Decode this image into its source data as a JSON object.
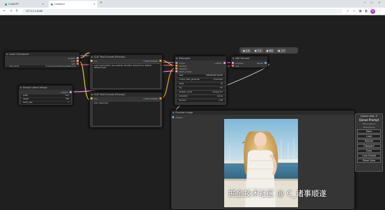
{
  "browser": {
    "tabs": [
      {
        "label": "ChatGPT",
        "active": false
      },
      {
        "label": "ComfyUI",
        "active": true
      }
    ],
    "url": "127.0.0.1:8188"
  },
  "nodes": {
    "load_checkpoint": {
      "title": "Load Checkpoint",
      "outputs": [
        "MODEL",
        "CLIP",
        "VAE"
      ],
      "widget_label": "ckpt_name",
      "widget_value": "v1-5-pruned-emaonly.safetensors"
    },
    "empty_latent": {
      "title": "Empty Latent Image",
      "output": "LATENT",
      "widgets": [
        {
          "label": "width",
          "value": "512"
        },
        {
          "label": "height",
          "value": "768"
        },
        {
          "label": "batch_size",
          "value": "1"
        }
      ]
    },
    "clip_pos": {
      "title": "CLIP Text Encode (Prompt)",
      "input": "clip",
      "output": "CONDITIONING",
      "text": "a girl, best quality, sea, seaside, beautiful, sharp focus, highres, detailed eyes"
    },
    "clip_neg": {
      "title": "CLIP Text Encode (Prompt)",
      "input": "clip",
      "output": "CONDITIONING",
      "text": "text, watermark"
    },
    "ksampler": {
      "title": "KSampler",
      "inputs": [
        "model",
        "positive",
        "negative",
        "latent_image"
      ],
      "output": "LATENT",
      "widgets": [
        {
          "label": "seed",
          "value": "156680208700286"
        },
        {
          "label": "control_after_generate",
          "value": "randomize"
        },
        {
          "label": "steps",
          "value": "20"
        },
        {
          "label": "cfg",
          "value": "8.0"
        },
        {
          "label": "sampler_name",
          "value": "dpmpp_2m"
        },
        {
          "label": "scheduler",
          "value": "karras"
        },
        {
          "label": "denoise",
          "value": "1.00"
        }
      ]
    },
    "vae_decode": {
      "title": "VAE Decode",
      "inputs": [
        "samples",
        "vae"
      ],
      "output": "IMAGE"
    },
    "preview": {
      "title": "Preview Image",
      "input": "images"
    }
  },
  "float_toolbar": [
    "■ 应用",
    "■ 节点",
    "■ 模型",
    "■ 工作"
  ],
  "menu": {
    "title": "Queue size: 0",
    "queue_button": "Queue Prompt",
    "extra_options": "Extra options",
    "view_queue": "View Queue",
    "buttons": [
      "Save",
      "Load",
      "Refresh",
      "Clipspace",
      "Clear",
      "Load Default",
      "Reset View"
    ]
  },
  "watermark": "掘金技术社区 @ C_诸事顺遂",
  "colors": {
    "clip_link": "#f5d342",
    "model_link": "#b39ddb",
    "latent_link": "#ff9cf9",
    "conditioning_link": "#ffa931",
    "vae_link": "#ff6e6e",
    "image_link": "#64b5f6"
  }
}
